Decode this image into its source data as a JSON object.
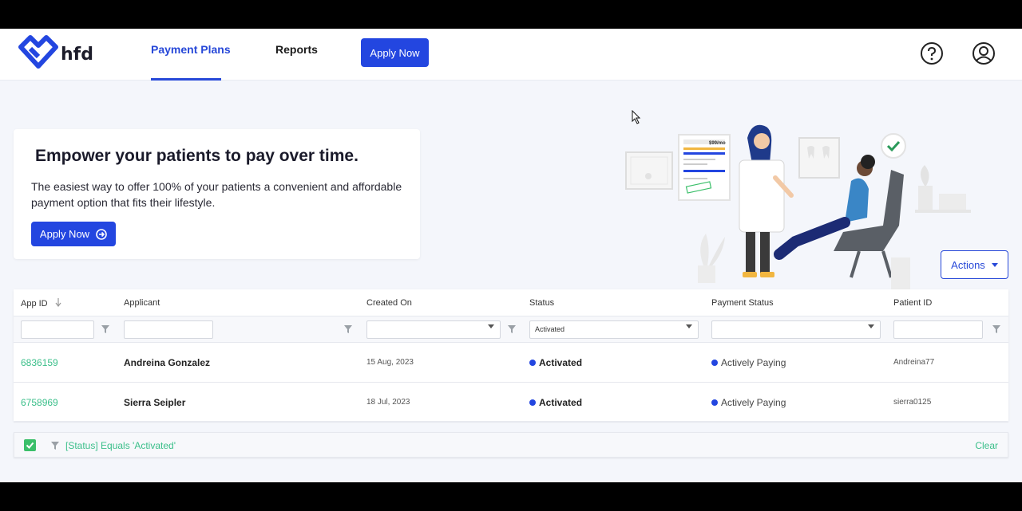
{
  "header": {
    "logo_text": "hfd",
    "tabs": [
      {
        "label": "Payment Plans",
        "active": true
      },
      {
        "label": "Reports",
        "active": false
      }
    ],
    "apply_label": "Apply Now",
    "help_icon": "question-circle-icon",
    "user_icon": "user-circle-icon"
  },
  "hero": {
    "title": "Empower your patients to pay over time.",
    "text": "The easiest way to offer 100% of your patients a convenient and affordable payment option that fits their lifestyle.",
    "apply_label": "Apply Now"
  },
  "illustration": {
    "price_tag": "$99/mo"
  },
  "actions": {
    "label": "Actions"
  },
  "grid": {
    "columns": [
      "App ID",
      "Applicant",
      "Created On",
      "Status",
      "Payment Status",
      "Patient ID"
    ],
    "filters": {
      "status_value": "Activated"
    },
    "rows": [
      {
        "app_id": "6836159",
        "applicant": "Andreina Gonzalez",
        "created_on": "15 Aug, 2023",
        "status": "Activated",
        "payment_status": "Actively Paying",
        "patient_id": "Andreina77"
      },
      {
        "app_id": "6758969",
        "applicant": "Sierra Seipler",
        "created_on": "18 Jul, 2023",
        "status": "Activated",
        "payment_status": "Actively Paying",
        "patient_id": "sierra0125"
      }
    ]
  },
  "filter_bar": {
    "text": "[Status] Equals 'Activated'",
    "clear_label": "Clear"
  },
  "colors": {
    "accent": "#2346e0",
    "link": "#3bbf8a",
    "check": "#3bbf6a"
  }
}
